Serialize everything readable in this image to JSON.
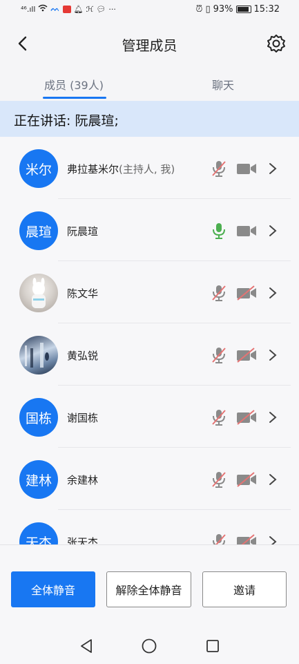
{
  "status_bar": {
    "left_text": "⁴⁶.ıll",
    "battery": "93%",
    "time": "15:32"
  },
  "header": {
    "title": "管理成员"
  },
  "tabs": {
    "members": "成员 (39人)",
    "chat": "聊天"
  },
  "banner": {
    "text": "正在讲话: 阮晨瑄;"
  },
  "participants": [
    {
      "avatar_text": "米尔",
      "name": "弗拉基米尔",
      "role": "(主持人, 我)",
      "mic": "muted",
      "camera": "on"
    },
    {
      "avatar_text": "晨瑄",
      "name": "阮晨瑄",
      "role": "",
      "mic": "active",
      "camera": "on"
    },
    {
      "avatar_text": "",
      "name": "陈文华",
      "role": "",
      "mic": "muted",
      "camera": "off"
    },
    {
      "avatar_text": "",
      "name": "黄弘锐",
      "role": "",
      "mic": "muted",
      "camera": "off"
    },
    {
      "avatar_text": "国栋",
      "name": "谢国栋",
      "role": "",
      "mic": "muted",
      "camera": "off"
    },
    {
      "avatar_text": "建林",
      "name": "余建林",
      "role": "",
      "mic": "muted",
      "camera": "off"
    },
    {
      "avatar_text": "天杰",
      "name": "张天杰",
      "role": "",
      "mic": "muted",
      "camera": "off"
    }
  ],
  "buttons": {
    "mute_all": "全体静音",
    "unmute_all": "解除全体静音",
    "invite": "邀请"
  },
  "colors": {
    "accent": "#1877f2",
    "banner_bg": "#d9e7fa",
    "mic_active": "#4caf50",
    "muted_slash": "#e57373"
  }
}
